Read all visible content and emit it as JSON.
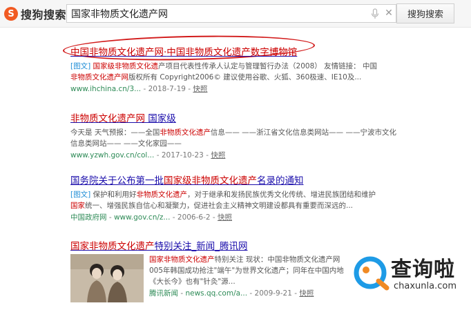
{
  "header": {
    "logo_text": "搜狗搜索",
    "query": "国家非物质文化遗产网",
    "search_button": "搜狗搜索"
  },
  "results": [
    {
      "title_parts": [
        "中国非物质文化遗产网",
        "·",
        "中国非物质文化遗产数字博物馆"
      ],
      "tag": "[图文]",
      "snippet_hl1": "国家级非物质文化遗",
      "snippet_rest1": "产项目代表性传承人认定与管理暂行办法（2008） 友情链接： 中国",
      "snippet_hl2": "非物质文化遗产网",
      "snippet_rest2": "版权所有 Copyright2006© 建议使用谷歌、火狐、360极速、IE10及...",
      "url": "www.ihchina.cn/3...",
      "date": "2018-7-19",
      "snapshot": "快照"
    },
    {
      "title_hl": "非物质文化遗产网",
      "title_rest": " 国家级",
      "snippet_a": "今天是  天气预报：——全国",
      "snippet_hl": "非物质文化遗产",
      "snippet_b": "信息—— ——浙江省文化信息类网站—— ——宁波市文化信息类网站—— ——文化家园——",
      "url": "www.yzwh.gov.cn/col...",
      "date": "2017-10-23",
      "snapshot": "快照"
    },
    {
      "title_a": "国务院关于公布第一批",
      "title_hl": "国家级非物质文化遗产",
      "title_b": "名录的通知",
      "tag": "[图文]",
      "snippet_a": " 保护和利用好",
      "snippet_hl1": "非物质文化遗产",
      "snippet_b": "，对于继承和发扬民族优秀文化传统、增进民族团结和维护",
      "snippet_hl2": "国家",
      "snippet_c": "统一、增强民族自信心和凝聚力，促进社会主义精神文明建设都具有重要而深远的...",
      "url_site": "中国政府网",
      "url": "www.gov.cn/z...",
      "date": "2006-6-2",
      "snapshot": "快照"
    },
    {
      "title_hl": "国家非物质文化遗产",
      "title_rest": "特别关注_新闻_腾讯网",
      "snippet_hl": "国家非物质文化遗产",
      "snippet_a": "特别关注 现状：中国非物质文化遗产网",
      "snippet_b": "005年韩国成功抢注\"端午\"为世界文化遗产；同年在中国内地",
      "snippet_c": "《大长今》也有\"针灸\"源...",
      "url_site": "腾讯新闻",
      "url": "news.qq.com/a...",
      "date": "2009-9-21",
      "snapshot": "快照"
    }
  ],
  "watermark": {
    "text": "查询啦",
    "url": "chaxunla.com"
  },
  "colors": {
    "link": "#1a0dab",
    "highlight": "#cc0000",
    "url": "#2e8b57",
    "annotation": "#d21a1a",
    "logo": "#f15a22"
  }
}
